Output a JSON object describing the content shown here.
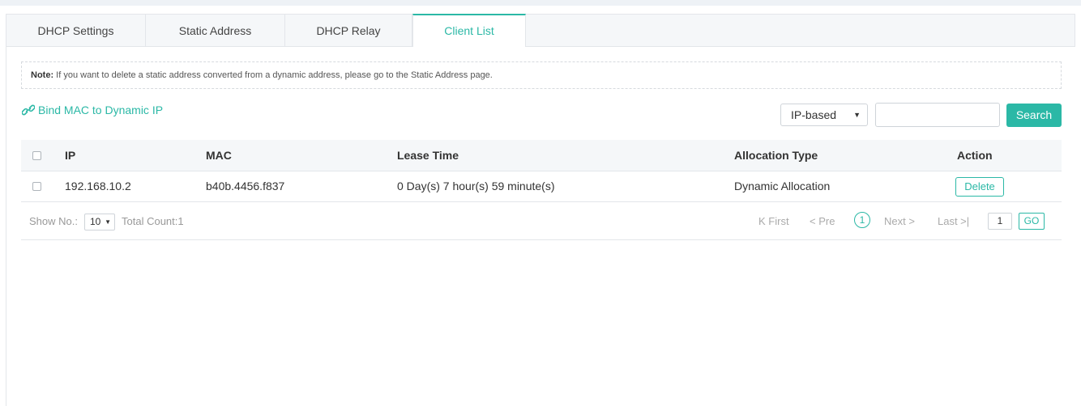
{
  "tabs": [
    {
      "label": "DHCP Settings"
    },
    {
      "label": "Static Address"
    },
    {
      "label": "DHCP Relay"
    },
    {
      "label": "Client List",
      "active": true
    }
  ],
  "note": {
    "label": "Note:",
    "text": " If you want to delete a static address converted from a dynamic address, please go to the Static Address page."
  },
  "bind_link": {
    "label": "Bind MAC to Dynamic IP",
    "icon": "link-icon"
  },
  "search": {
    "select_value": "IP-based",
    "input_value": "",
    "button_label": "Search"
  },
  "table": {
    "headers": [
      "IP",
      "MAC",
      "Lease Time",
      "Allocation Type",
      "Action"
    ],
    "rows": [
      {
        "ip": "192.168.10.2",
        "mac": "b40b.4456.f837",
        "lease": "0 Day(s) 7 hour(s) 59 minute(s)",
        "type": "Dynamic Allocation",
        "action": "Delete"
      }
    ]
  },
  "footer": {
    "show_label": "Show No.:",
    "page_size": "10",
    "total": "Total Count:1",
    "first": "K First",
    "prev": "< Pre",
    "current_page": "1",
    "next": "Next >",
    "last": "Last >|",
    "goto_value": "1",
    "go_label": "GO"
  },
  "colors": {
    "accent": "#2bb8a6"
  }
}
